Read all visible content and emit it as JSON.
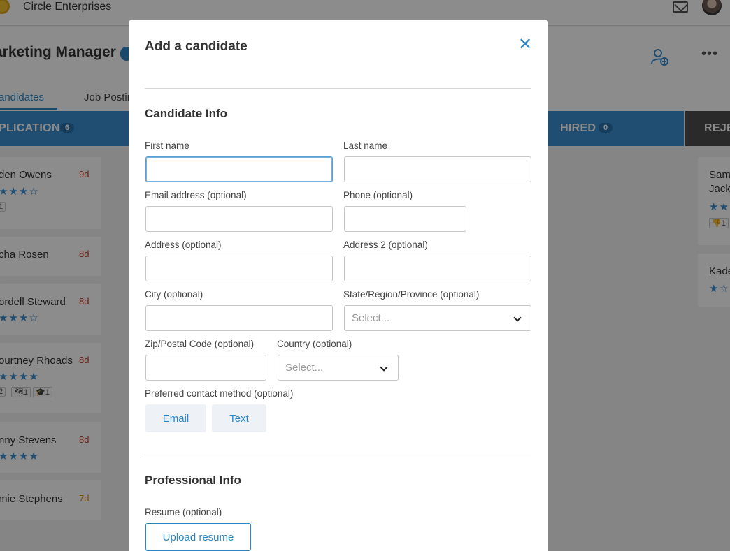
{
  "app": {
    "company": "Circle Enterprises",
    "job_title": "arketing Manager",
    "tabs": [
      "andidates",
      "Job Postin"
    ]
  },
  "stages": [
    {
      "label": "PLICATION",
      "count": "6"
    },
    {
      "label": "HIRED",
      "count": "0"
    },
    {
      "label": "REJE",
      "count": ""
    }
  ],
  "cards_left": [
    {
      "name": "den Owens",
      "age": "9d",
      "stars": "★★★☆",
      "tags": [
        "1"
      ]
    },
    {
      "name": "cha Rosen",
      "age": "8d",
      "stars": "",
      "tags": []
    },
    {
      "name": "ordell Steward",
      "age": "8d",
      "stars": "★★★☆",
      "tags": []
    },
    {
      "name": "ourtney Rhoads",
      "age": "8d",
      "stars": "★★★★",
      "tags": [
        "2",
        "🗺1",
        "🎓1"
      ]
    },
    {
      "name": "nny Stevens",
      "age": "8d",
      "stars": "★★★★",
      "tags": []
    },
    {
      "name": "mie Stephens",
      "age": "7d",
      "stars": "",
      "tags": []
    }
  ],
  "cards_right": [
    {
      "name": "Sam",
      "name2": "Jack",
      "stars": "★★",
      "tags": [
        "👎1"
      ]
    },
    {
      "name": "Kade",
      "stars": "★☆"
    }
  ],
  "colors": {
    "accent": "#2c86c4",
    "stage_blue": "#3a8ed0",
    "age_red": "#c0392b",
    "age_orange": "#e08e0b"
  },
  "modal": {
    "title": "Add a candidate",
    "close_icon": "close-icon",
    "candidate_section": "Candidate Info",
    "fields": {
      "first_name": {
        "label": "First name",
        "value": "",
        "placeholder": ""
      },
      "last_name": {
        "label": "Last name",
        "value": "",
        "placeholder": ""
      },
      "email": {
        "label": "Email address (optional)",
        "value": "",
        "placeholder": ""
      },
      "phone": {
        "label": "Phone (optional)",
        "value": "",
        "placeholder": ""
      },
      "address": {
        "label": "Address (optional)",
        "value": "",
        "placeholder": ""
      },
      "address2": {
        "label": "Address 2 (optional)",
        "value": "",
        "placeholder": ""
      },
      "city": {
        "label": "City (optional)",
        "value": "",
        "placeholder": ""
      },
      "state": {
        "label": "State/Region/Province (optional)",
        "selected": "Select..."
      },
      "zip": {
        "label": "Zip/Postal Code (optional)",
        "value": "",
        "placeholder": ""
      },
      "country": {
        "label": "Country (optional)",
        "selected": "Select..."
      }
    },
    "contact_method": {
      "label": "Preferred contact method (optional)",
      "options": [
        "Email",
        "Text"
      ]
    },
    "professional_section": "Professional Info",
    "resume": {
      "label": "Resume (optional)",
      "button": "Upload resume"
    }
  }
}
